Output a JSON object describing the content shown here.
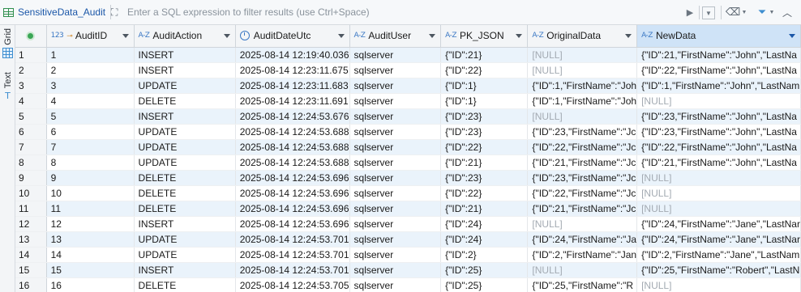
{
  "filter_bar": {
    "table_name": "SensitiveData_Audit",
    "placeholder": "Enter a SQL expression to filter results (use Ctrl+Space)"
  },
  "left_bar": {
    "grid_label": "Grid",
    "text_label": "Text"
  },
  "columns": [
    {
      "label": "AuditID",
      "type": "123",
      "key": true
    },
    {
      "label": "AuditAction",
      "type": "A-Z"
    },
    {
      "label": "AuditDateUtc",
      "type": "clock"
    },
    {
      "label": "AuditUser",
      "type": "A-Z"
    },
    {
      "label": "PK_JSON",
      "type": "A-Z"
    },
    {
      "label": "OriginalData",
      "type": "A-Z"
    },
    {
      "label": "NewData",
      "type": "A-Z",
      "sorted": true
    }
  ],
  "rows": [
    {
      "num": "1",
      "cells": [
        "1",
        "INSERT",
        "2025-08-14 12:19:40.036",
        "sqlserver",
        "{\"ID\":21}",
        "[NULL]",
        "{\"ID\":21,\"FirstName\":\"John\",\"LastNa"
      ]
    },
    {
      "num": "2",
      "cells": [
        "2",
        "INSERT",
        "2025-08-14 12:23:11.675",
        "sqlserver",
        "{\"ID\":22}",
        "[NULL]",
        "{\"ID\":22,\"FirstName\":\"John\",\"LastNa"
      ]
    },
    {
      "num": "3",
      "cells": [
        "3",
        "UPDATE",
        "2025-08-14 12:23:11.683",
        "sqlserver",
        "{\"ID\":1}",
        "{\"ID\":1,\"FirstName\":\"Joh",
        "{\"ID\":1,\"FirstName\":\"John\",\"LastNam"
      ]
    },
    {
      "num": "4",
      "cells": [
        "4",
        "DELETE",
        "2025-08-14 12:23:11.691",
        "sqlserver",
        "{\"ID\":1}",
        "{\"ID\":1,\"FirstName\":\"Joh",
        "[NULL]"
      ]
    },
    {
      "num": "5",
      "cells": [
        "5",
        "INSERT",
        "2025-08-14 12:24:53.676",
        "sqlserver",
        "{\"ID\":23}",
        "[NULL]",
        "{\"ID\":23,\"FirstName\":\"John\",\"LastNa"
      ]
    },
    {
      "num": "6",
      "cells": [
        "6",
        "UPDATE",
        "2025-08-14 12:24:53.688",
        "sqlserver",
        "{\"ID\":23}",
        "{\"ID\":23,\"FirstName\":\"Jc",
        "{\"ID\":23,\"FirstName\":\"John\",\"LastNa"
      ]
    },
    {
      "num": "7",
      "cells": [
        "7",
        "UPDATE",
        "2025-08-14 12:24:53.688",
        "sqlserver",
        "{\"ID\":22}",
        "{\"ID\":22,\"FirstName\":\"Jc",
        "{\"ID\":22,\"FirstName\":\"John\",\"LastNa"
      ]
    },
    {
      "num": "8",
      "cells": [
        "8",
        "UPDATE",
        "2025-08-14 12:24:53.688",
        "sqlserver",
        "{\"ID\":21}",
        "{\"ID\":21,\"FirstName\":\"Jc",
        "{\"ID\":21,\"FirstName\":\"John\",\"LastNa"
      ]
    },
    {
      "num": "9",
      "cells": [
        "9",
        "DELETE",
        "2025-08-14 12:24:53.696",
        "sqlserver",
        "{\"ID\":23}",
        "{\"ID\":23,\"FirstName\":\"Jc",
        "[NULL]"
      ]
    },
    {
      "num": "10",
      "cells": [
        "10",
        "DELETE",
        "2025-08-14 12:24:53.696",
        "sqlserver",
        "{\"ID\":22}",
        "{\"ID\":22,\"FirstName\":\"Jc",
        "[NULL]"
      ]
    },
    {
      "num": "11",
      "cells": [
        "11",
        "DELETE",
        "2025-08-14 12:24:53.696",
        "sqlserver",
        "{\"ID\":21}",
        "{\"ID\":21,\"FirstName\":\"Jc",
        "[NULL]"
      ]
    },
    {
      "num": "12",
      "cells": [
        "12",
        "INSERT",
        "2025-08-14 12:24:53.696",
        "sqlserver",
        "{\"ID\":24}",
        "[NULL]",
        "{\"ID\":24,\"FirstName\":\"Jane\",\"LastNar"
      ]
    },
    {
      "num": "13",
      "cells": [
        "13",
        "UPDATE",
        "2025-08-14 12:24:53.701",
        "sqlserver",
        "{\"ID\":24}",
        "{\"ID\":24,\"FirstName\":\"Ja",
        "{\"ID\":24,\"FirstName\":\"Jane\",\"LastNar"
      ]
    },
    {
      "num": "14",
      "cells": [
        "14",
        "UPDATE",
        "2025-08-14 12:24:53.701",
        "sqlserver",
        "{\"ID\":2}",
        "{\"ID\":2,\"FirstName\":\"Jan",
        "{\"ID\":2,\"FirstName\":\"Jane\",\"LastNam"
      ]
    },
    {
      "num": "15",
      "cells": [
        "15",
        "INSERT",
        "2025-08-14 12:24:53.701",
        "sqlserver",
        "{\"ID\":25}",
        "[NULL]",
        "{\"ID\":25,\"FirstName\":\"Robert\",\"LastN"
      ]
    },
    {
      "num": "16",
      "cells": [
        "16",
        "DELETE",
        "2025-08-14 12:24:53.705",
        "sqlserver",
        "{\"ID\":25}",
        "{\"ID\":25,\"FirstName\":\"R",
        "[NULL]"
      ]
    }
  ],
  "colors": {
    "accent": "#1b57a8",
    "null_text": "#a3aab2",
    "alt_row": "#eaf3fb",
    "sorted_header": "#cfe3f7"
  },
  "icons": {
    "table": "table-icon",
    "expand": "expand-icon",
    "play": "play-icon",
    "history": "history-dropdown-icon",
    "eraser": "eraser-icon",
    "filter": "filter-icon",
    "collapse": "chevron-up-icon",
    "grid": "grid-icon",
    "text": "text-icon",
    "check": "status-check-icon",
    "clock": "clock-icon"
  }
}
